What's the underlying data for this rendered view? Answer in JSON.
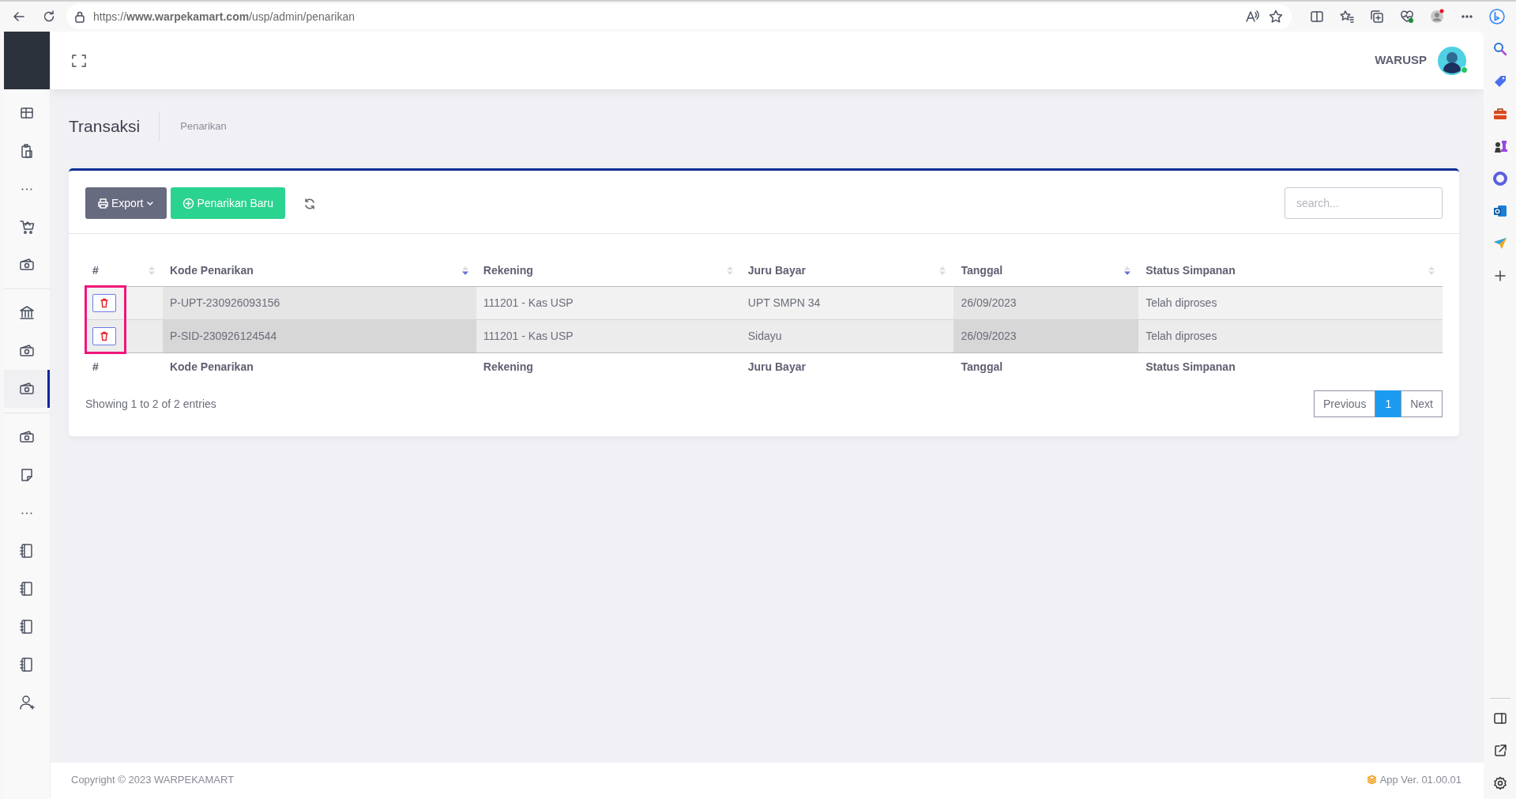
{
  "browser": {
    "url": "https://**www.warpekamart.com**/usp/admin/penarikan"
  },
  "sidebar": {
    "groups": [
      {
        "items": [
          {
            "selected": false
          },
          {
            "selected": false
          },
          {
            "selected": false
          },
          {
            "selected": false
          },
          {
            "selected": false
          }
        ]
      },
      {
        "items": [
          {
            "selected": false
          },
          {
            "selected": false
          },
          {
            "selected": true
          }
        ]
      },
      {
        "items": [
          {
            "selected": false
          },
          {
            "selected": false
          },
          {
            "selected": false
          },
          {
            "selected": false
          },
          {
            "selected": false
          },
          {
            "selected": false
          },
          {
            "selected": false
          },
          {
            "selected": false
          }
        ]
      }
    ]
  },
  "header": {
    "user": {
      "name": "WARUSP",
      "online": true
    }
  },
  "page": {
    "title": "Transaksi",
    "breadcrumb": "Penarikan"
  },
  "toolbar": {
    "export_button": "Export",
    "new_button": "Penarikan Baru",
    "search": {
      "placeholder": "search..."
    }
  },
  "table": {
    "highlight_actions": true,
    "columns": [
      {
        "label": "#",
        "sorted": false
      },
      {
        "label": "Kode Penarikan",
        "sorted": true
      },
      {
        "label": "Rekening",
        "sorted": false
      },
      {
        "label": "Juru Bayar",
        "sorted": false
      },
      {
        "label": "Tanggal",
        "sorted": true
      },
      {
        "label": "Status Simpanan",
        "sorted": false
      }
    ],
    "rows": [
      {
        "hovered": false,
        "cells": [
          "",
          "P-UPT-230926093156",
          "111201 - Kas USP",
          "UPT SMPN 34",
          "26/09/2023",
          "Telah diproses"
        ]
      },
      {
        "hovered": true,
        "cells": [
          "",
          "P-SID-230926124544",
          "111201 - Kas USP",
          "Sidayu",
          "26/09/2023",
          "Telah diproses"
        ]
      }
    ],
    "footer_columns": [
      "#",
      "Kode Penarikan",
      "Rekening",
      "Juru Bayar",
      "Tanggal",
      "Status Simpanan"
    ],
    "info": "Showing 1 to 2 of 2 entries",
    "pagination": {
      "previous": "Previous",
      "pages": [
        {
          "label": "1",
          "selected": true
        }
      ],
      "next": "Next"
    }
  },
  "footer": {
    "copyright": "Copyright © 2023 WARPEKAMART",
    "version": "App Ver. 01.00.01"
  }
}
